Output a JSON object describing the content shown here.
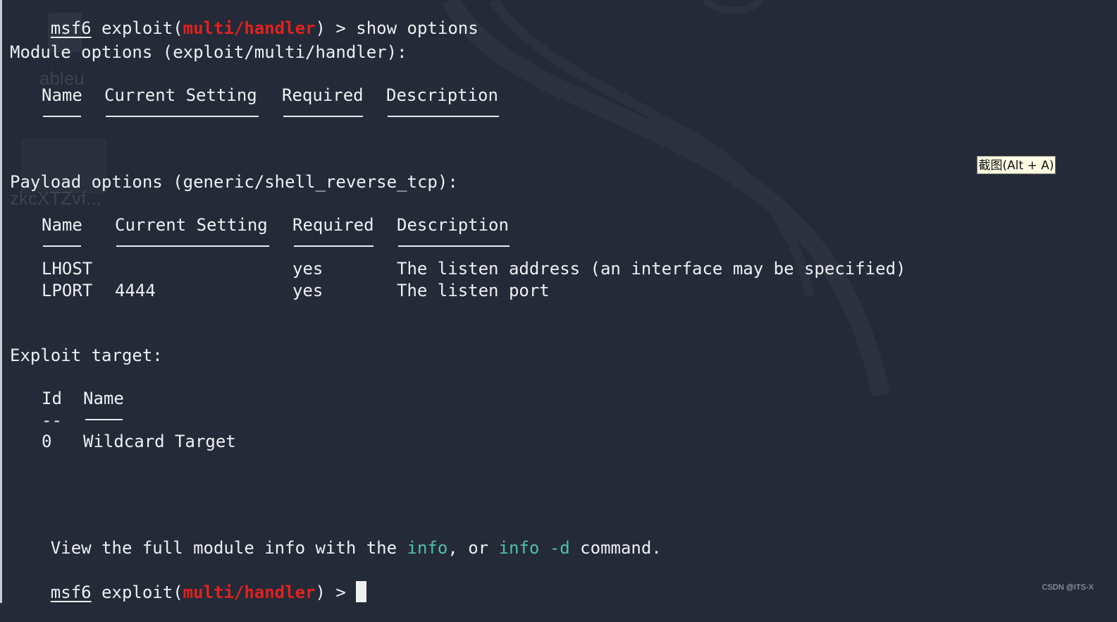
{
  "prompt": {
    "user": "msf6",
    "pre": " exploit(",
    "module": "multi/handler",
    "post": ") > ",
    "command": "show options"
  },
  "module_options": {
    "heading": "Module options (exploit/multi/handler):",
    "headers": [
      "Name",
      "Current Setting",
      "Required",
      "Description"
    ]
  },
  "payload_options": {
    "heading": "Payload options (generic/shell_reverse_tcp):",
    "headers": [
      "Name",
      "Current Setting",
      "Required",
      "Description"
    ],
    "rows": [
      {
        "name": "LHOST",
        "setting": "",
        "required": "yes",
        "description": "The listen address (an interface may be specified)"
      },
      {
        "name": "LPORT",
        "setting": "4444",
        "required": "yes",
        "description": "The listen port"
      }
    ]
  },
  "exploit_target": {
    "heading": "Exploit target:",
    "headers": [
      "Id",
      "Name"
    ],
    "separator_id": "--",
    "rows": [
      {
        "id": "0",
        "name": "Wildcard Target"
      }
    ]
  },
  "info_line": {
    "pre": "View the full module info with the ",
    "cmd1": "info",
    "mid": ", or ",
    "cmd2": "info -d",
    "post": " command."
  },
  "final_prompt": {
    "user": "msf6",
    "pre": " exploit(",
    "module": "multi/handler",
    "post": ") > "
  },
  "tooltip": "截图(Alt + A)",
  "watermark": "CSDN @ITS-X",
  "desktop_labels": [
    "ableu",
    "zkcXTZvf..."
  ],
  "colors": {
    "background": "#242a37",
    "module": "#e0221f",
    "highlight": "#4fc1a7",
    "text": "#eef0f4"
  }
}
